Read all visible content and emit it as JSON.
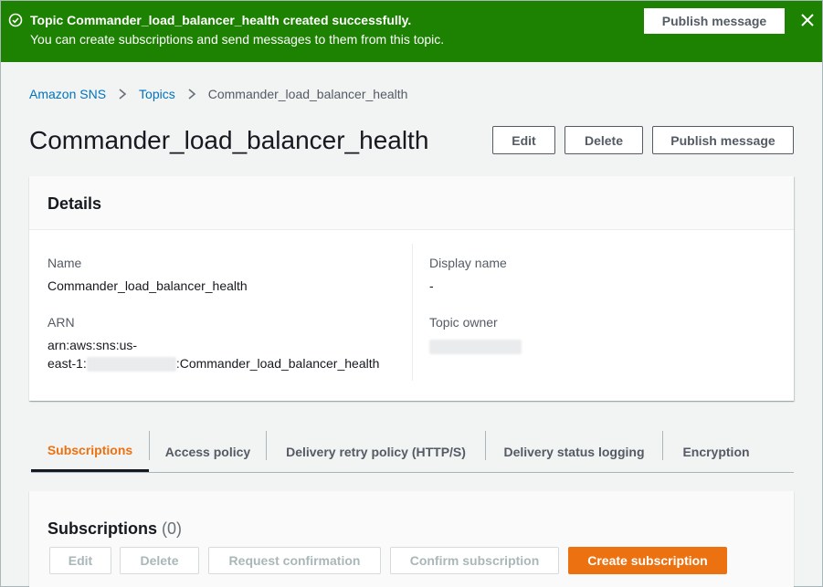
{
  "flash": {
    "title": "Topic Commander_load_balancer_health created successfully.",
    "description": "You can create subscriptions and send messages to them from this topic.",
    "publish_button": "Publish message",
    "color": "#1d8102"
  },
  "breadcrumb": {
    "items": [
      "Amazon SNS",
      "Topics"
    ],
    "current": "Commander_load_balancer_health"
  },
  "page": {
    "title": "Commander_load_balancer_health",
    "edit_button": "Edit",
    "delete_button": "Delete",
    "publish_button": "Publish message"
  },
  "details": {
    "heading": "Details",
    "name_label": "Name",
    "name_value": "Commander_load_balancer_health",
    "arn_label": "ARN",
    "arn_line1": "arn:aws:sns:us-",
    "arn_line2_prefix": "east-1:",
    "arn_line2_suffix": ":Commander_load_balancer_health",
    "display_name_label": "Display name",
    "display_name_value": "-",
    "topic_owner_label": "Topic owner"
  },
  "tabs": [
    {
      "label": "Subscriptions",
      "active": true
    },
    {
      "label": "Access policy",
      "active": false
    },
    {
      "label": "Delivery retry policy (HTTP/S)",
      "active": false
    },
    {
      "label": "Delivery status logging",
      "active": false
    },
    {
      "label": "Encryption",
      "active": false
    }
  ],
  "subscriptions": {
    "title": "Subscriptions",
    "count": "(0)",
    "buttons": {
      "edit": "Edit",
      "delete": "Delete",
      "request_confirmation": "Request confirmation",
      "confirm_subscription": "Confirm subscription",
      "create_subscription": "Create subscription"
    }
  },
  "colors": {
    "accent": "#ec7211",
    "link": "#0073bb",
    "success": "#1d8102"
  },
  "icons": {
    "flash": "check-circle-icon",
    "close": "close-icon",
    "breadcrumb_separator": "chevron-right-icon"
  }
}
